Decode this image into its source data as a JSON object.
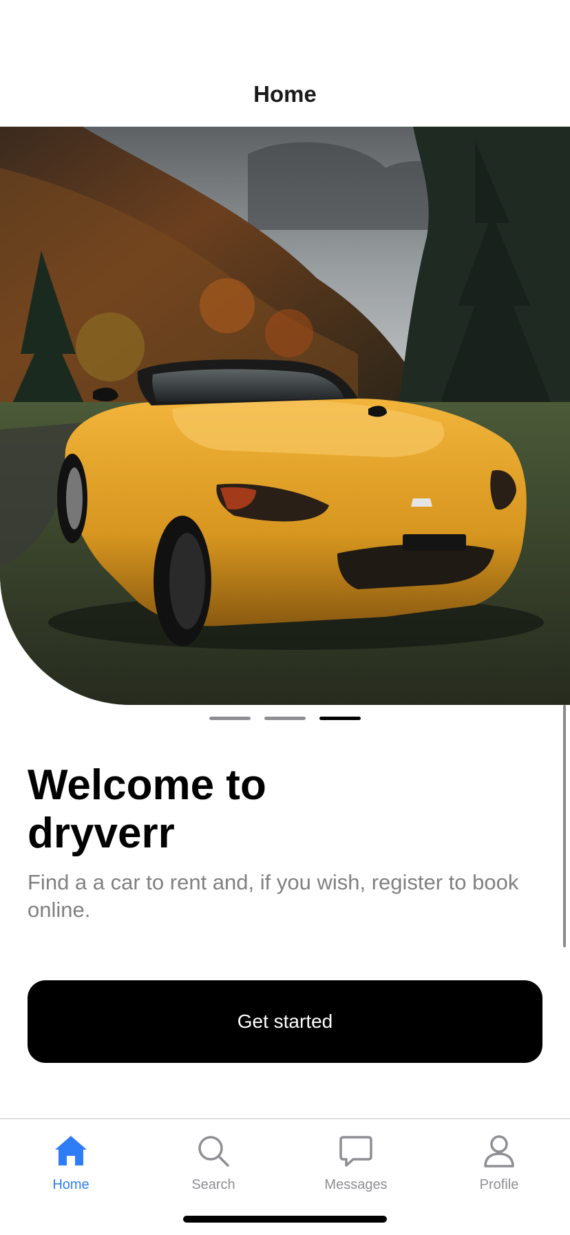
{
  "header": {
    "title": "Home"
  },
  "hero": {
    "image_label": "Yellow sports car parked on grass"
  },
  "pager": {
    "count": 3,
    "active_index": 2
  },
  "welcome": {
    "title_line1": "Welcome to",
    "title_line2": "dryverr",
    "subtitle": "Find a a car to rent and, if you wish, register to book online."
  },
  "cta": {
    "label": "Get started"
  },
  "tabbar": {
    "items": [
      {
        "label": "Home",
        "icon": "home-icon",
        "active": true
      },
      {
        "label": "Search",
        "icon": "search-icon",
        "active": false
      },
      {
        "label": "Messages",
        "icon": "messages-icon",
        "active": false
      },
      {
        "label": "Profile",
        "icon": "profile-icon",
        "active": false
      }
    ]
  },
  "colors": {
    "accent": "#2f7df6",
    "inactive": "#8e8e93",
    "button_bg": "#000000",
    "subtitle": "#808080"
  }
}
